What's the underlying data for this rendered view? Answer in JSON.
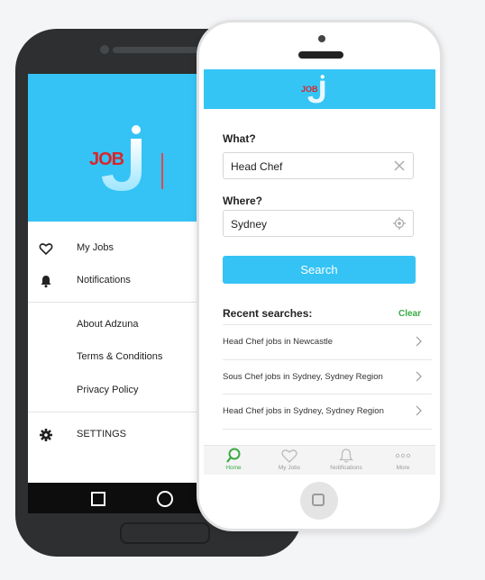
{
  "android": {
    "logo_text": "JOB",
    "menu": {
      "my_jobs": "My Jobs",
      "notifications": "Notifications",
      "about": "About Adzuna",
      "terms": "Terms & Conditions",
      "privacy": "Privacy Policy",
      "settings": "SETTINGS"
    },
    "icons": [
      "heart-icon",
      "bell-icon",
      "gear-icon",
      "back-square-icon",
      "home-circle-icon"
    ]
  },
  "iphone": {
    "logo_text": "JOB",
    "what_label": "What?",
    "what_value": "Head Chef",
    "where_label": "Where?",
    "where_value": "Sydney",
    "search_label": "Search",
    "recent_title": "Recent searches:",
    "clear_label": "Clear",
    "recent": [
      "Head Chef jobs in Newcastle",
      "Sous Chef jobs in Sydney, Sydney Region",
      "Head Chef jobs in Sydney, Sydney Region"
    ],
    "tabs": {
      "home": "Home",
      "my_jobs": "My Jobs",
      "notifications": "Notifications",
      "more": "More"
    }
  },
  "colors": {
    "brand_blue": "#35c3f5",
    "accent_green": "#3aab45",
    "logo_red": "#d8262c"
  }
}
